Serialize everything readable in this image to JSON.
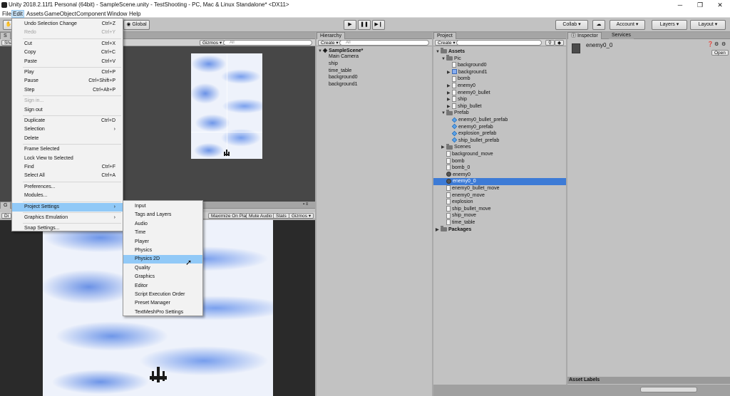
{
  "window": {
    "title": "Unity 2018.2.11f1 Personal (64bit) - SampleScene.unity - TestShooting - PC, Mac & Linux Standalone* <DX11>",
    "minimize": "─",
    "restore": "❐",
    "close": "✕"
  },
  "menubar": [
    "File",
    "Edit",
    "Assets",
    "GameObject",
    "Component",
    "Window",
    "Help"
  ],
  "toolbar": {
    "pivot": "Global",
    "collab": "Collab ▾",
    "cloud": "☁",
    "account": "Account ▾",
    "layers": "Layers ▾",
    "layout": "Layout ▾"
  },
  "scene": {
    "gizmos": "Gizmos ▾",
    "search_placeholder": "All",
    "tab_short": "S",
    "shaded_short": "Sha"
  },
  "game": {
    "maximize": "Maximize On Play",
    "mute": "Mute Audio",
    "stats": "Stats",
    "gizmos": "Gizmos ▾",
    "tab_short": "G",
    "display_short": "Di"
  },
  "hierarchy": {
    "tab": "Hierarchy",
    "create": "Create ▾",
    "search_placeholder": "All",
    "scene": "SampleScene*",
    "items": [
      "Main Camera",
      "ship",
      "time_table",
      "background0",
      "background1"
    ]
  },
  "project": {
    "tab": "Project",
    "create": "Create ▾",
    "tree": [
      {
        "label": "Assets",
        "level": 0,
        "kind": "folder",
        "arrow": "▼",
        "bold": true
      },
      {
        "label": "Pic",
        "level": 1,
        "kind": "folder",
        "arrow": "▼"
      },
      {
        "label": "background0",
        "level": 2,
        "kind": "file",
        "arrow": ""
      },
      {
        "label": "background1",
        "level": 2,
        "kind": "tex",
        "arrow": "▶"
      },
      {
        "label": "bomb",
        "level": 2,
        "kind": "file",
        "arrow": ""
      },
      {
        "label": "enemy0",
        "level": 2,
        "kind": "file",
        "arrow": "▶"
      },
      {
        "label": "enemy0_bullet",
        "level": 2,
        "kind": "file",
        "arrow": "▶"
      },
      {
        "label": "ship",
        "level": 2,
        "kind": "file",
        "arrow": "▶"
      },
      {
        "label": "ship_bullet",
        "level": 2,
        "kind": "file",
        "arrow": "▶"
      },
      {
        "label": "Prefab",
        "level": 1,
        "kind": "folder",
        "arrow": "▼"
      },
      {
        "label": "enemy0_bullet_prefab",
        "level": 2,
        "kind": "prefab",
        "arrow": ""
      },
      {
        "label": "enemy0_prefab",
        "level": 2,
        "kind": "prefab",
        "arrow": ""
      },
      {
        "label": "explosion_prefab",
        "level": 2,
        "kind": "prefab",
        "arrow": ""
      },
      {
        "label": "ship_bullet_prefab",
        "level": 2,
        "kind": "prefab",
        "arrow": ""
      },
      {
        "label": "Scenes",
        "level": 1,
        "kind": "folder",
        "arrow": "▶"
      },
      {
        "label": "background_move",
        "level": 1,
        "kind": "file",
        "arrow": ""
      },
      {
        "label": "bomb",
        "level": 1,
        "kind": "file",
        "arrow": ""
      },
      {
        "label": "bomb_0",
        "level": 1,
        "kind": "file",
        "arrow": ""
      },
      {
        "label": "enemy0",
        "level": 1,
        "kind": "script",
        "arrow": ""
      },
      {
        "label": "enemy0_0",
        "level": 1,
        "kind": "script",
        "arrow": "",
        "selected": true
      },
      {
        "label": "enemy0_bullet_move",
        "level": 1,
        "kind": "file",
        "arrow": ""
      },
      {
        "label": "enemy0_move",
        "level": 1,
        "kind": "file",
        "arrow": ""
      },
      {
        "label": "explosion",
        "level": 1,
        "kind": "file",
        "arrow": ""
      },
      {
        "label": "ship_bullet_move",
        "level": 1,
        "kind": "file",
        "arrow": ""
      },
      {
        "label": "ship_move",
        "level": 1,
        "kind": "file",
        "arrow": ""
      },
      {
        "label": "time_table",
        "level": 1,
        "kind": "file",
        "arrow": ""
      },
      {
        "label": "Packages",
        "level": 0,
        "kind": "folder",
        "arrow": "▶",
        "bold": true
      }
    ]
  },
  "inspector": {
    "tab": "Inspector",
    "tab2": "Services",
    "object": "enemy0_0",
    "open": "Open",
    "asset_labels": "Asset Labels"
  },
  "edit_menu": [
    {
      "label": "Undo Selection Change",
      "shortcut": "Ctrl+Z"
    },
    {
      "label": "Redo",
      "shortcut": "Ctrl+Y",
      "disabled": true
    },
    {
      "sep": true
    },
    {
      "label": "Cut",
      "shortcut": "Ctrl+X"
    },
    {
      "label": "Copy",
      "shortcut": "Ctrl+C"
    },
    {
      "label": "Paste",
      "shortcut": "Ctrl+V"
    },
    {
      "sep": true
    },
    {
      "label": "Play",
      "shortcut": "Ctrl+P"
    },
    {
      "label": "Pause",
      "shortcut": "Ctrl+Shift+P"
    },
    {
      "label": "Step",
      "shortcut": "Ctrl+Alt+P"
    },
    {
      "sep": true
    },
    {
      "label": "Sign in...",
      "shortcut": "",
      "disabled": true
    },
    {
      "label": "Sign out",
      "shortcut": ""
    },
    {
      "sep": true
    },
    {
      "label": "Duplicate",
      "shortcut": "Ctrl+D"
    },
    {
      "label": "Selection",
      "shortcut": "›"
    },
    {
      "label": "Delete",
      "shortcut": ""
    },
    {
      "sep": true
    },
    {
      "label": "Frame Selected",
      "shortcut": ""
    },
    {
      "label": "Lock View to Selected",
      "shortcut": ""
    },
    {
      "label": "Find",
      "shortcut": "Ctrl+F"
    },
    {
      "label": "Select All",
      "shortcut": "Ctrl+A"
    },
    {
      "sep": true
    },
    {
      "label": "Preferences...",
      "shortcut": ""
    },
    {
      "label": "Modules...",
      "shortcut": ""
    },
    {
      "sep": true
    },
    {
      "label": "Project Settings",
      "shortcut": "›",
      "highlight": true
    },
    {
      "sep": true
    },
    {
      "label": "Graphics Emulation",
      "shortcut": "›"
    },
    {
      "sep": true
    },
    {
      "label": "Snap Settings...",
      "shortcut": ""
    }
  ],
  "project_settings_menu": [
    "Input",
    "Tags and Layers",
    "Audio",
    "Time",
    "Player",
    "Physics",
    "Physics 2D",
    "Quality",
    "Graphics",
    "Editor",
    "Script Execution Order",
    "Preset Manager",
    "TextMeshPro Settings"
  ],
  "project_settings_highlight": "Physics 2D"
}
